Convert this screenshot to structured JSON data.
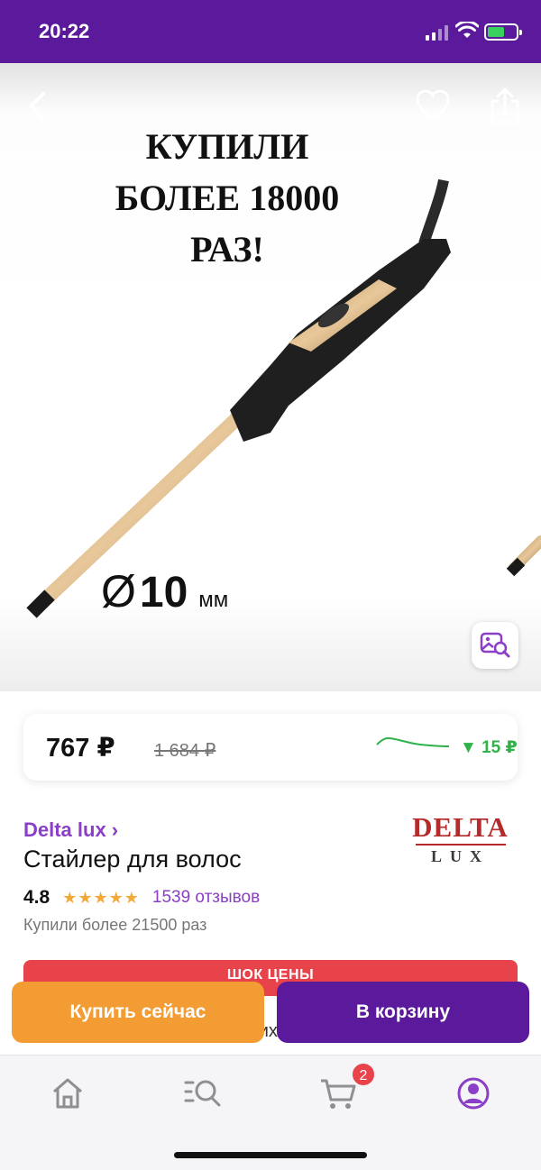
{
  "status_bar": {
    "time": "20:22"
  },
  "hero": {
    "promo_lines": [
      "КУПИЛИ",
      "БОЛЕЕ 18000",
      "РАЗ!"
    ],
    "diameter_symbol": "Ø",
    "diameter_value": "10",
    "diameter_unit": "мм"
  },
  "price": {
    "current": "767 ₽",
    "old": "1 684 ₽",
    "drop": "▼ 15 ₽",
    "trend_color": "#2fb24a"
  },
  "product": {
    "brand": "Delta lux ›",
    "title": "Стайлер для волос",
    "rating": "4.8",
    "stars": "★★★★★",
    "reviews": "1539 отзывов",
    "bought": "Купили более 21500 раз",
    "logo_line1": "DELTA",
    "logo_line2": "LUX"
  },
  "promo_banner": "ШОК ЦЕНЫ",
  "description": "Стайлер для создания мелких локонов. Керамическое покрытие рабочей",
  "actions": {
    "buy_now": "Купить сейчас",
    "add_to_cart": "В корзину"
  },
  "tabbar": {
    "items": [
      "home-icon",
      "catalog-search-icon",
      "cart-icon",
      "profile-icon"
    ],
    "cart_badge": "2",
    "active_color": "#8a3fc6"
  },
  "colors": {
    "brand_purple": "#5b1a9c",
    "accent_orange": "#f39c33",
    "accent_red": "#e8424a"
  }
}
